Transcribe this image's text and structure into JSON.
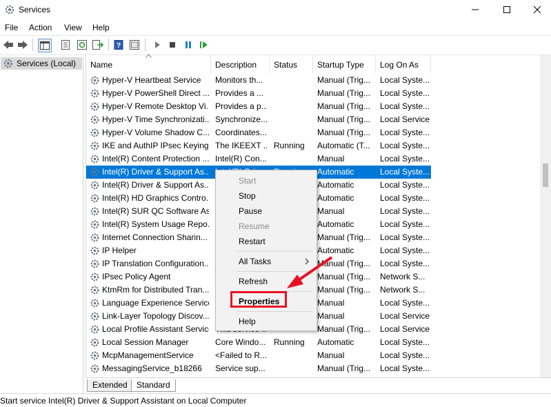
{
  "window": {
    "title": "Services",
    "minimize_icon": "minimize-icon",
    "maximize_icon": "maximize-icon",
    "close_icon": "close-icon"
  },
  "menu": [
    "File",
    "Action",
    "View",
    "Help"
  ],
  "tree": {
    "root_label": "Services (Local)"
  },
  "columns": [
    "Name",
    "Description",
    "Status",
    "Startup Type",
    "Log On As"
  ],
  "rows": [
    {
      "name": "Hyper-V Heartbeat Service",
      "description": "Monitors th...",
      "status": "",
      "startup": "Manual (Trig...",
      "logon": "Local Syste..."
    },
    {
      "name": "Hyper-V PowerShell Direct ...",
      "description": "Provides a ...",
      "status": "",
      "startup": "Manual (Trig...",
      "logon": "Local Syste..."
    },
    {
      "name": "Hyper-V Remote Desktop Vi...",
      "description": "Provides a p...",
      "status": "",
      "startup": "Manual (Trig...",
      "logon": "Local Syste..."
    },
    {
      "name": "Hyper-V Time Synchronizati...",
      "description": "Synchronize...",
      "status": "",
      "startup": "Manual (Trig...",
      "logon": "Local Service"
    },
    {
      "name": "Hyper-V Volume Shadow C...",
      "description": "Coordinates...",
      "status": "",
      "startup": "Manual (Trig...",
      "logon": "Local Syste..."
    },
    {
      "name": "IKE and AuthIP IPsec Keying...",
      "description": "The IKEEXT ...",
      "status": "Running",
      "startup": "Automatic (T...",
      "logon": "Local Syste..."
    },
    {
      "name": "Intel(R) Content Protection ...",
      "description": "Intel(R) Con...",
      "status": "",
      "startup": "Manual",
      "logon": "Local Syste..."
    },
    {
      "name": "Intel(R) Driver & Support As...",
      "description": "Intel(R) Dri...",
      "status": "Running",
      "startup": "Automatic",
      "logon": "Local Syste..."
    },
    {
      "name": "Intel(R) Driver & Support As...",
      "description": "",
      "status": "",
      "startup": "Automatic",
      "logon": "Local Syste..."
    },
    {
      "name": "Intel(R) HD Graphics Contro...",
      "description": "",
      "status": "",
      "startup": "Automatic",
      "logon": "Local Syste..."
    },
    {
      "name": "Intel(R) SUR QC Software As...",
      "description": "",
      "status": "",
      "startup": "Manual",
      "logon": "Local Syste..."
    },
    {
      "name": "Intel(R) System Usage Repo...",
      "description": "",
      "status": "",
      "startup": "Automatic",
      "logon": "Local Syste..."
    },
    {
      "name": "Internet Connection Sharin...",
      "description": "",
      "status": "",
      "startup": "Manual (Trig...",
      "logon": "Local Syste..."
    },
    {
      "name": "IP Helper",
      "description": "",
      "status": "",
      "startup": "Automatic",
      "logon": "Local Syste..."
    },
    {
      "name": "IP Translation Configuration...",
      "description": "",
      "status": "",
      "startup": "Manual (Trig...",
      "logon": "Local Syste..."
    },
    {
      "name": "IPsec Policy Agent",
      "description": "",
      "status": "",
      "startup": "Manual (Trig...",
      "logon": "Network S..."
    },
    {
      "name": "KtmRm for Distributed Tran...",
      "description": "",
      "status": "",
      "startup": "Manual (Trig...",
      "logon": "Network S..."
    },
    {
      "name": "Language Experience Service",
      "description": "",
      "status": "",
      "startup": "Manual",
      "logon": "Local Syste..."
    },
    {
      "name": "Link-Layer Topology Discov...",
      "description": "",
      "status": "",
      "startup": "Manual",
      "logon": "Local Service"
    },
    {
      "name": "Local Profile Assistant Service",
      "description": "This service ...",
      "status": "",
      "startup": "Manual (Trig...",
      "logon": "Local Service"
    },
    {
      "name": "Local Session Manager",
      "description": "Core Windo...",
      "status": "Running",
      "startup": "Automatic",
      "logon": "Local Syste..."
    },
    {
      "name": "McpManagementService",
      "description": "<Failed to R...",
      "status": "",
      "startup": "Manual",
      "logon": "Local Syste..."
    },
    {
      "name": "MessagingService_b18266",
      "description": "Service sup...",
      "status": "",
      "startup": "Manual (Trig...",
      "logon": "Local Syste..."
    }
  ],
  "context_menu": {
    "start": "Start",
    "stop": "Stop",
    "pause": "Pause",
    "resume": "Resume",
    "restart": "Restart",
    "all_tasks": "All Tasks",
    "refresh": "Refresh",
    "properties": "Properties",
    "help": "Help"
  },
  "tabs": [
    "Extended",
    "Standard"
  ],
  "status": "Start service Intel(R) Driver & Support Assistant on Local Computer",
  "colors": {
    "selection": "#0078d7",
    "highlight": "#e81123"
  }
}
